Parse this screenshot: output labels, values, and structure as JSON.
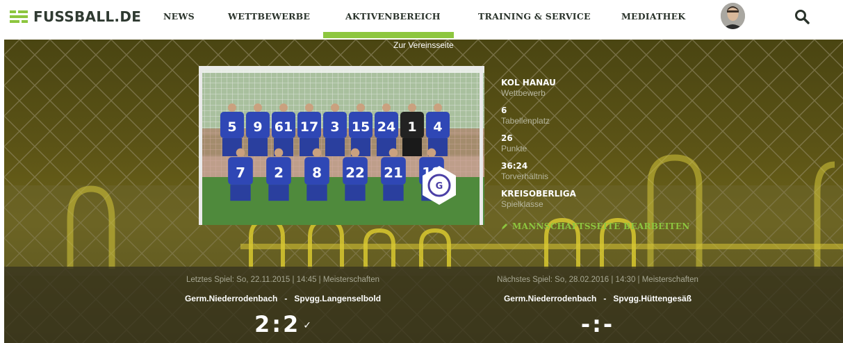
{
  "brand": {
    "name": "FUSSBALL.DE",
    "accent": "#8dc63f"
  },
  "nav": {
    "items": [
      "NEWS",
      "WETTBEWERBE",
      "AKTIVENBEREICH",
      "TRAINING & SERVICE",
      "MEDIATHEK"
    ],
    "active": "AKTIVENBEREICH",
    "search_icon": "search-icon",
    "avatar": "user-avatar"
  },
  "hero": {
    "club_link": "Zur Vereinsseite",
    "stats": [
      {
        "value": "KOL HANAU",
        "label": "Wettbewerb"
      },
      {
        "value": "6",
        "label": "Tabellenplatz"
      },
      {
        "value": "26",
        "label": "Punkte"
      },
      {
        "value": "36:24",
        "label": "Torverhältnis"
      },
      {
        "value": "KREISOBERLIGA",
        "label": "Spielklasse"
      }
    ],
    "edit_link": "MANNSCHAFTSSEITE BEARBEITEN",
    "jersey_numbers_back": [
      "5",
      "9",
      "61",
      "17",
      "3",
      "15",
      "24",
      "1",
      "4"
    ],
    "jersey_numbers_front": [
      "7",
      "2",
      "8",
      "22",
      "21",
      "18"
    ]
  },
  "last_match": {
    "meta": "Letztes Spiel: So, 22.11.2015 | 14:45 | Meisterschaften",
    "home": "Germ.Niederrodenbach",
    "sep": "-",
    "away": "Spvgg.Langenselbold",
    "score": "2:2",
    "check": "✓"
  },
  "next_match": {
    "meta": "Nächstes Spiel: So, 28.02.2016 | 14:30 | Meisterschaften",
    "home": "Germ.Niederrodenbach",
    "sep": "-",
    "away": "Spvgg.Hüttengesäß",
    "score": "-:-"
  }
}
